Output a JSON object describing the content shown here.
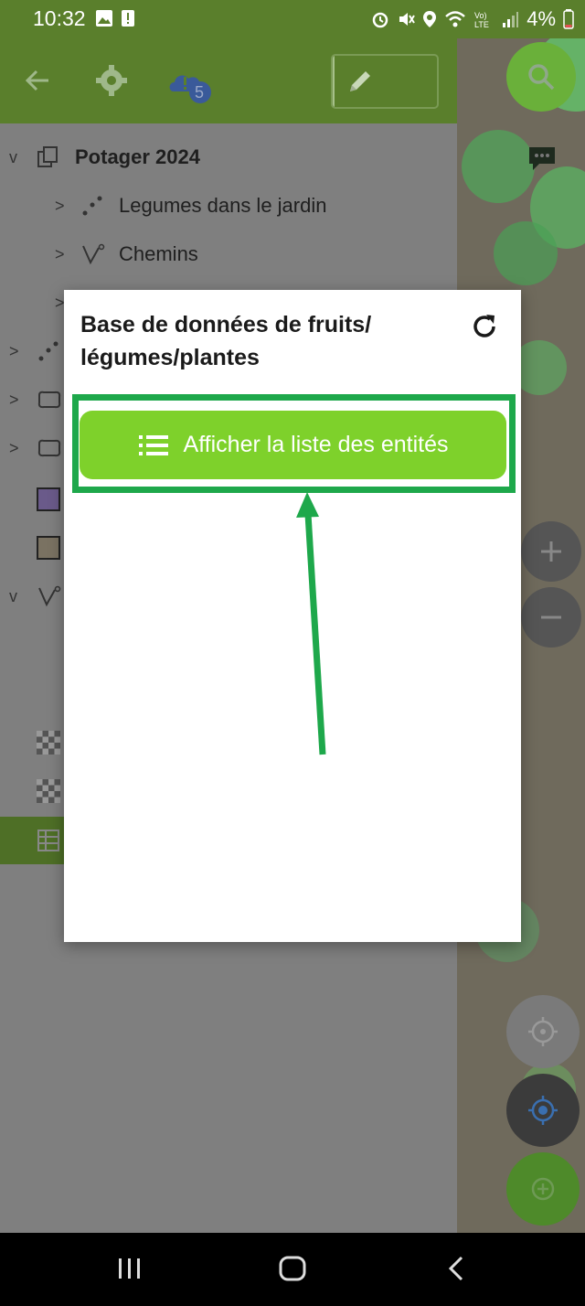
{
  "status_bar": {
    "time": "10:32",
    "battery": "4%"
  },
  "toolbar": {
    "back": "back-arrow-icon",
    "settings": "gear-icon",
    "cloud": "cloud-alert-icon",
    "cloud_badge": "5"
  },
  "layers": [
    {
      "label": "Potager 2024",
      "chev": "v"
    },
    {
      "label": "Legumes dans le jardin",
      "chev": ">"
    },
    {
      "label": "Chemins",
      "chev": ">"
    }
  ],
  "dialog": {
    "title": "Base de données de fruits/ légumes/plantes",
    "button_label": "Afficher la liste des entités"
  },
  "colors": {
    "accent": "#7ed12b",
    "highlight": "#1ea84b",
    "toolbar": "#5a7f2c"
  }
}
